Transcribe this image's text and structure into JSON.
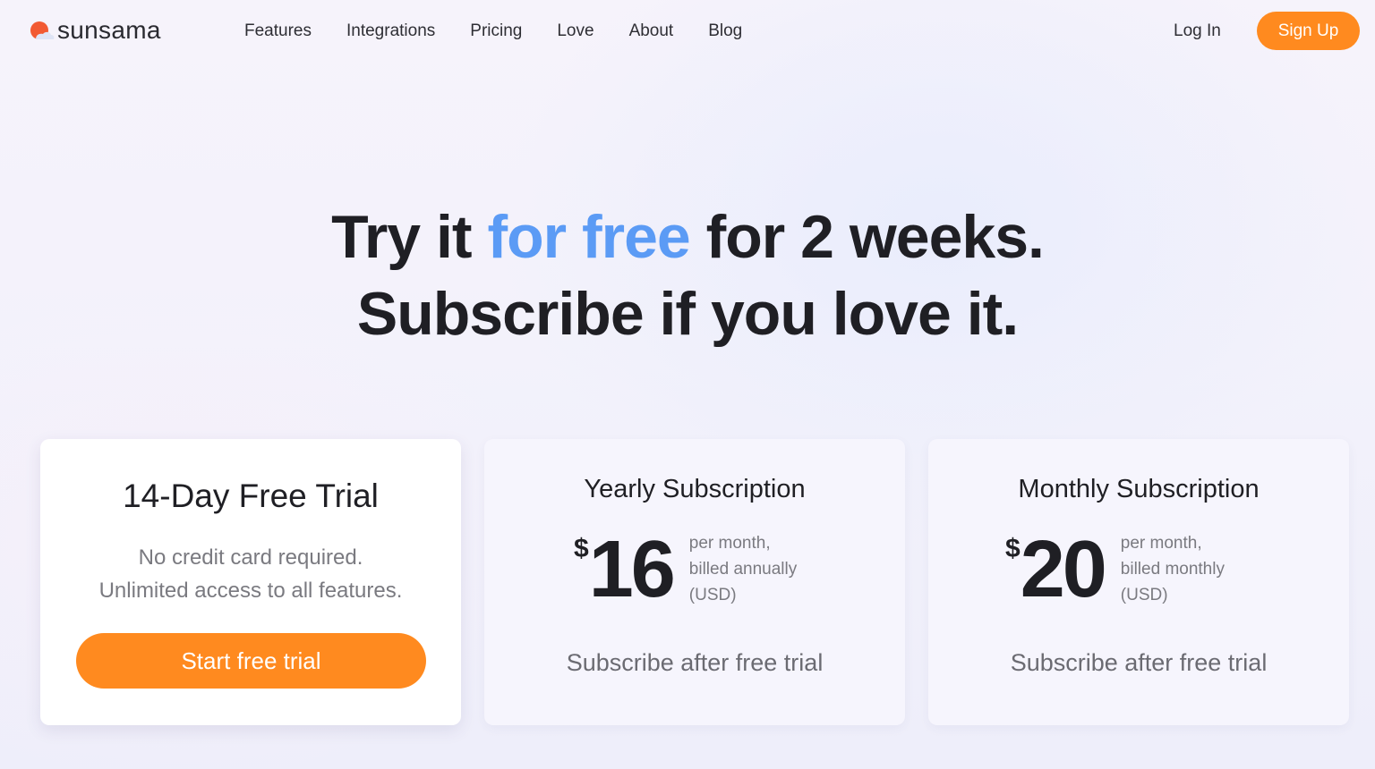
{
  "nav": {
    "logo_text": "sunsama",
    "links": [
      "Features",
      "Integrations",
      "Pricing",
      "Love",
      "About",
      "Blog"
    ],
    "login_label": "Log In",
    "signup_label": "Sign Up"
  },
  "hero": {
    "line1_pre": "Try it ",
    "line1_accent": "for free",
    "line1_post": " for 2 weeks.",
    "line2": "Subscribe if you love it."
  },
  "cards": {
    "trial": {
      "title": "14-Day Free Trial",
      "desc_line1": "No credit card required.",
      "desc_line2": "Unlimited access to all features.",
      "button_label": "Start free trial"
    },
    "yearly": {
      "title": "Yearly Subscription",
      "currency": "$",
      "amount": "16",
      "note_line1": "per month,",
      "note_line2": "billed annually",
      "note_line3": "(USD)",
      "cta": "Subscribe after free trial"
    },
    "monthly": {
      "title": "Monthly Subscription",
      "currency": "$",
      "amount": "20",
      "note_line1": "per month,",
      "note_line2": "billed monthly",
      "note_line3": "(USD)",
      "cta": "Subscribe after free trial"
    }
  },
  "colors": {
    "accent_orange": "#ff8a1f",
    "accent_blue": "#5b9bf5",
    "text_dark": "#1f1f24",
    "text_muted": "#7a7a80"
  },
  "icons": {
    "logo": "sunsama-sun-cloud-icon"
  }
}
